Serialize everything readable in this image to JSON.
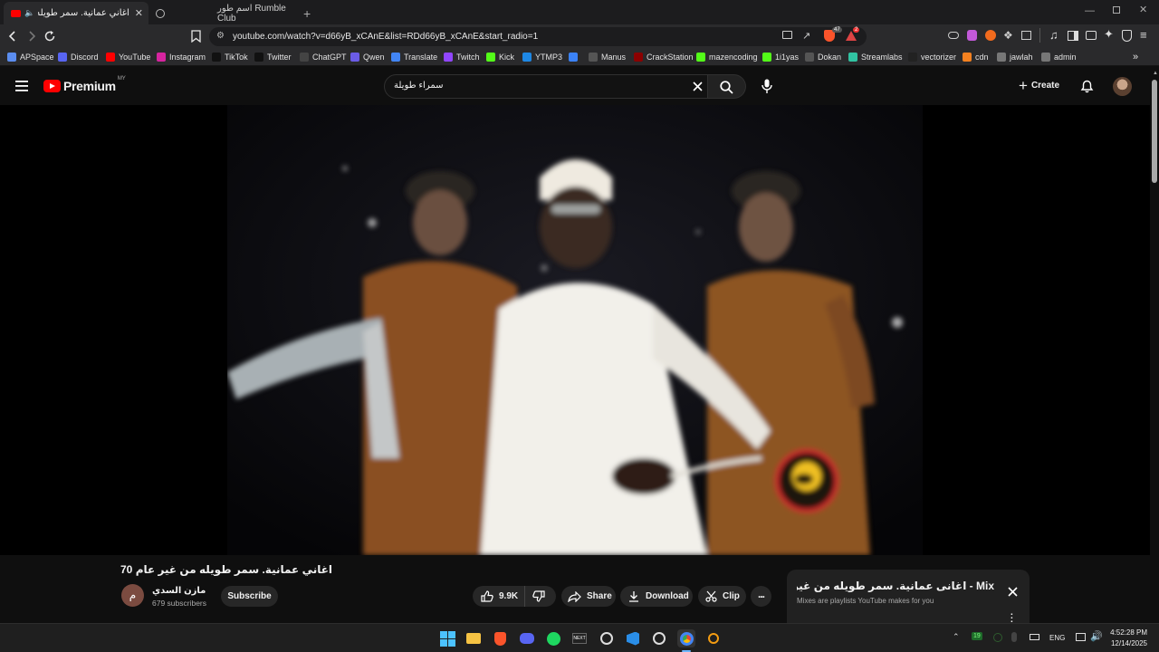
{
  "browser": {
    "tabs": [
      {
        "title": "اغاني عمانية. سمر طويله من",
        "active": true
      },
      {
        "title": "",
        "active": false
      },
      {
        "title": "اسم طور Rumble Club",
        "active": false
      }
    ],
    "new_tab_symbol": "+",
    "url": "youtube.com/watch?v=d66yB_xCAnE&list=RDd66yB_xCAnE&start_radio=1",
    "badge_counts": {
      "brave": "47",
      "alert": "2"
    }
  },
  "bookmarks": [
    {
      "label": "APSpace",
      "color": "#5b8def"
    },
    {
      "label": "Discord",
      "color": "#5865f2"
    },
    {
      "label": "YouTube",
      "color": "#ff0000"
    },
    {
      "label": "Instagram",
      "color": "#d6249f"
    },
    {
      "label": "TikTok",
      "color": "#111111"
    },
    {
      "label": "Twitter",
      "color": "#111111"
    },
    {
      "label": "ChatGPT",
      "color": "#444444"
    },
    {
      "label": "Qwen",
      "color": "#6b5ce7"
    },
    {
      "label": "Translate",
      "color": "#4285f4"
    },
    {
      "label": "Twitch",
      "color": "#9146ff"
    },
    {
      "label": "Kick",
      "color": "#53fc18"
    },
    {
      "label": "YTMP3",
      "color": "#1e88e5"
    },
    {
      "label": "",
      "color": "#3b82f6"
    },
    {
      "label": "Manus",
      "color": "#555555"
    },
    {
      "label": "CrackStation",
      "color": "#8b0000"
    },
    {
      "label": "mazencoding",
      "color": "#53fc18"
    },
    {
      "label": "1i1yas",
      "color": "#53fc18"
    },
    {
      "label": "Dokan",
      "color": "#555555"
    },
    {
      "label": "Streamlabs",
      "color": "#31c3a2"
    },
    {
      "label": "vectorizer",
      "color": "#222222"
    },
    {
      "label": "cdn",
      "color": "#f48120"
    },
    {
      "label": "jawlah",
      "color": "#777777"
    },
    {
      "label": "admin",
      "color": "#777777"
    }
  ],
  "youtube": {
    "logo_text": "Premium",
    "region": "MY",
    "search_value": "سمراء طويلة",
    "create_label": "Create"
  },
  "video": {
    "title": "اغاني عمانية. سمر طويله من غير عام 70",
    "channel_name": "مازن السدي",
    "channel_initial": "م",
    "subscribers": "679 subscribers",
    "subscribe_label": "Subscribe",
    "likes": "9.9K",
    "share_label": "Share",
    "download_label": "Download",
    "clip_label": "Clip",
    "more_label": "..."
  },
  "mix_panel": {
    "title": "Mix - اغانى عمانية. سمر طويله من غير...",
    "subtitle": "Mixes are playlists YouTube makes for you"
  },
  "taskbar": {
    "tray_badge": "19",
    "language": "ENG",
    "time": "4:52:28 PM",
    "date": "12/14/2025"
  },
  "colors": {
    "youtube_red": "#ff0000",
    "background": "#0f0f0f",
    "chrome_bg": "#2a2a2c"
  }
}
